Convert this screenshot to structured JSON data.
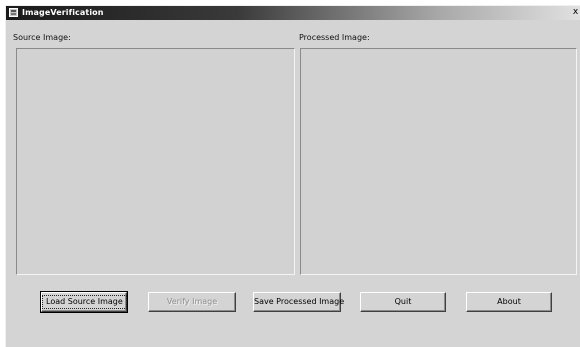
{
  "window": {
    "title": "ImageVerification",
    "close_glyph": "x",
    "app_icon": "app-window-icon"
  },
  "labels": {
    "source": "Source Image:",
    "processed": "Processed Image:"
  },
  "buttons": {
    "load": "Load Source Image",
    "verify": "Verify Image",
    "save": "Save Processed Image",
    "quit": "Quit",
    "about": "About"
  },
  "states": {
    "verify_enabled": false,
    "default_button": "load"
  }
}
